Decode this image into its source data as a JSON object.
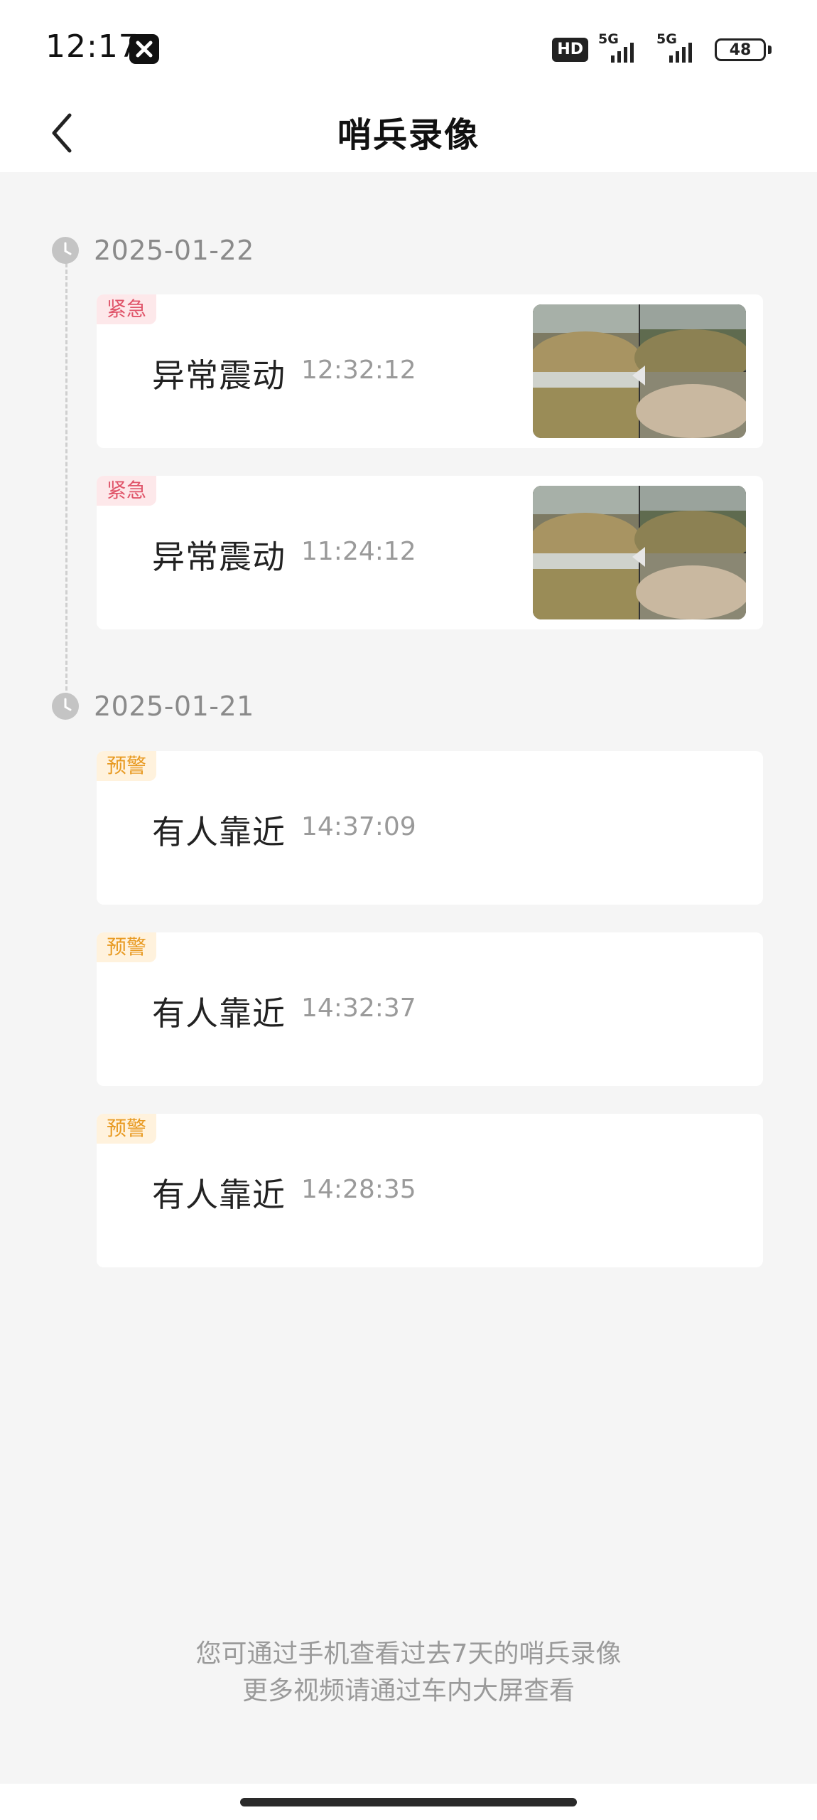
{
  "status_bar": {
    "time": "12:17",
    "hd_label": "HD",
    "signal_1_label": "5G",
    "signal_2_label": "5G",
    "battery": "48"
  },
  "header": {
    "title": "哨兵录像"
  },
  "groups": [
    {
      "date": "2025-01-22",
      "events": [
        {
          "tag": "紧急",
          "tag_type": "urgent",
          "name": "异常震动",
          "time": "12:32:12",
          "has_thumbnail": true
        },
        {
          "tag": "紧急",
          "tag_type": "urgent",
          "name": "异常震动",
          "time": "11:24:12",
          "has_thumbnail": true
        }
      ]
    },
    {
      "date": "2025-01-21",
      "events": [
        {
          "tag": "预警",
          "tag_type": "warning",
          "name": "有人靠近",
          "time": "14:37:09",
          "has_thumbnail": false
        },
        {
          "tag": "预警",
          "tag_type": "warning",
          "name": "有人靠近",
          "time": "14:32:37",
          "has_thumbnail": false
        },
        {
          "tag": "预警",
          "tag_type": "warning",
          "name": "有人靠近",
          "time": "14:28:35",
          "has_thumbnail": false
        }
      ]
    }
  ],
  "footer": {
    "line1": "您可通过手机查看过去7天的哨兵录像",
    "line2": "更多视频请通过车内大屏查看"
  },
  "colors": {
    "urgent_text": "#e0556a",
    "urgent_bg": "#fde8ea",
    "warning_text": "#e89a22",
    "warning_bg": "#fff2dd",
    "page_bg": "#f5f5f5"
  }
}
